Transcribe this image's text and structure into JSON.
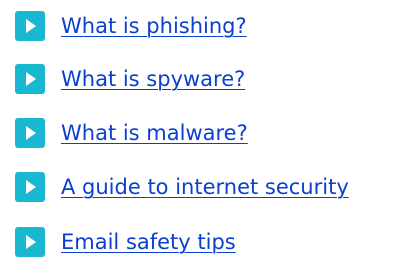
{
  "colors": {
    "icon_background": "#18b8d0",
    "icon_arrow": "#ffffff",
    "link": "#0b3fcf"
  },
  "links": {
    "items": [
      {
        "label": "What is phishing?",
        "icon": "play-arrow-icon"
      },
      {
        "label": "What is spyware?",
        "icon": "play-arrow-icon"
      },
      {
        "label": "What is malware?",
        "icon": "play-arrow-icon"
      },
      {
        "label": "A guide to internet security",
        "icon": "play-arrow-icon"
      },
      {
        "label": "Email safety tips",
        "icon": "play-arrow-icon"
      }
    ]
  }
}
